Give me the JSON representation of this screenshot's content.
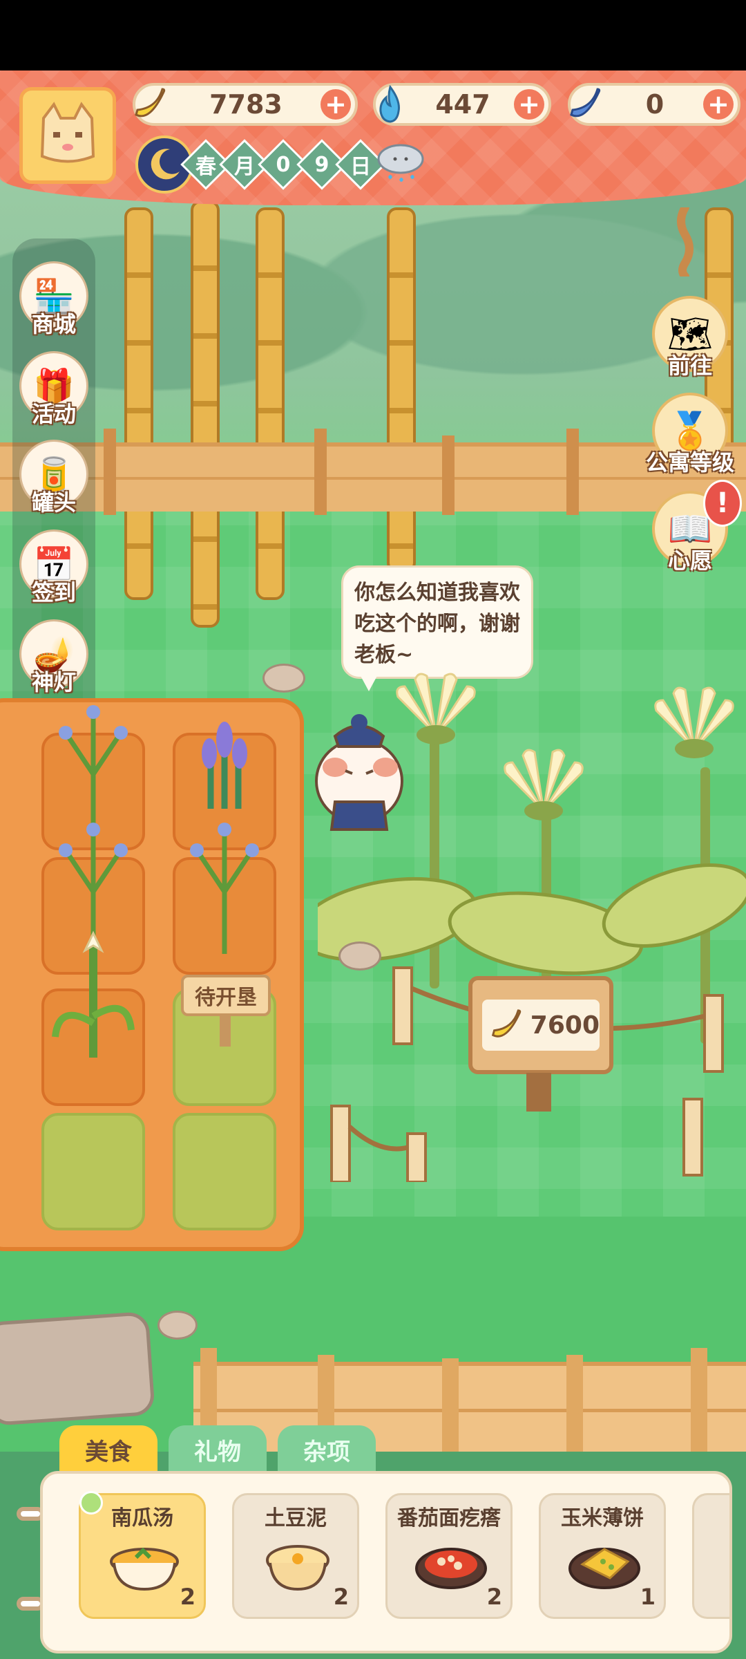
{
  "resources": [
    {
      "icon": "banana-icon",
      "value": "7783"
    },
    {
      "icon": "blue-flame-icon",
      "value": "447"
    },
    {
      "icon": "blue-banana-icon",
      "value": "0"
    }
  ],
  "date": {
    "season": "春",
    "month_label": "月",
    "digit1": "0",
    "digit2": "9",
    "day_label": "日",
    "weather_icon": "rain-cloud-icon"
  },
  "side_menu": [
    {
      "label": "商城",
      "icon": "shop-icon"
    },
    {
      "label": "活动",
      "icon": "gift-icon"
    },
    {
      "label": "罐头",
      "icon": "can-icon"
    },
    {
      "label": "签到",
      "icon": "calendar-icon"
    },
    {
      "label": "神灯",
      "icon": "magic-lamp-icon"
    }
  ],
  "right_menu": [
    {
      "label": "前往",
      "icon": "map-icon"
    },
    {
      "label": "公寓等级",
      "icon": "apartment-level-icon"
    },
    {
      "label": "心愿",
      "icon": "wish-book-icon"
    }
  ],
  "speech": {
    "text": "你怎么知道我喜欢吃这个的啊，谢谢老板~"
  },
  "plot": {
    "pending_label": "待开垦"
  },
  "sign": {
    "price": "7600"
  },
  "tabs": [
    {
      "label": "美食",
      "active": true
    },
    {
      "label": "礼物",
      "active": false
    },
    {
      "label": "杂项",
      "active": false
    }
  ],
  "items": [
    {
      "name": "南瓜汤",
      "qty": "2",
      "selected": true
    },
    {
      "name": "土豆泥",
      "qty": "2",
      "selected": false
    },
    {
      "name": "番茄面疙瘩",
      "qty": "2",
      "selected": false
    },
    {
      "name": "玉米薄饼",
      "qty": "1",
      "selected": false
    }
  ],
  "colors": {
    "header": "#f27a5c",
    "grass": "#5fcb77",
    "tab_active": "#ffcf3c"
  }
}
